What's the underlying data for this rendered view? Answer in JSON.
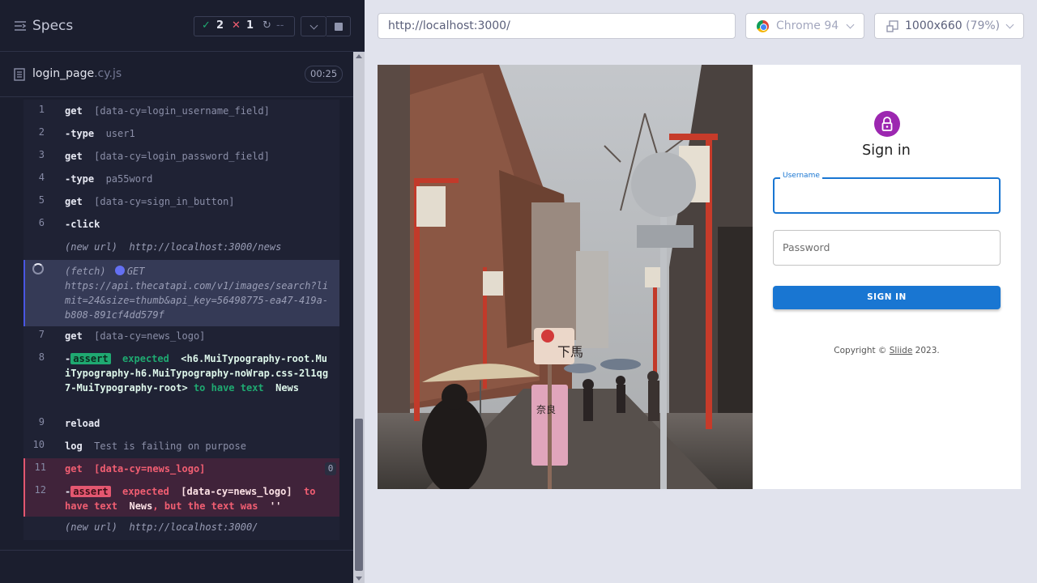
{
  "reporter": {
    "header": {
      "title": "Specs",
      "passed_count": "2",
      "failed_count": "1",
      "pending_count": "--"
    },
    "spec": {
      "file_name": "login_page",
      "file_ext": ".cy.js",
      "duration": "00:25"
    },
    "commands": [
      {
        "num": "1",
        "name": "get",
        "arg": "[data-cy=login_username_field]"
      },
      {
        "num": "2",
        "name": "-type",
        "arg": "user1"
      },
      {
        "num": "3",
        "name": "get",
        "arg": "[data-cy=login_password_field]"
      },
      {
        "num": "4",
        "name": "-type",
        "arg": "pa55word"
      },
      {
        "num": "5",
        "name": "get",
        "arg": "[data-cy=sign_in_button]"
      },
      {
        "num": "6",
        "name": "-click",
        "arg": ""
      },
      {
        "num": "",
        "name": "(new url)",
        "arg": "http://localhost:3000/news"
      },
      {
        "num": "",
        "name": "(fetch)",
        "method": "GET",
        "arg": "https://api.thecatapi.com/v1/images/search?limit=24&size=thumb&api_key=56498775-ea47-419a-b808-891cf4dd579f"
      },
      {
        "num": "7",
        "name": "get",
        "arg": "[data-cy=news_logo]"
      },
      {
        "num": "8",
        "dash": "-",
        "badge": "assert",
        "expected_label": "expected",
        "element": "<h6.MuiTypography-root.MuiTypography-h6.MuiTypography-noWrap.css-2l1qg7-MuiTypography-root>",
        "to_have": "to have text",
        "value": "News"
      },
      {
        "num": "9",
        "name": "reload",
        "arg": ""
      },
      {
        "num": "10",
        "name": "log",
        "arg": "Test is failing on purpose"
      },
      {
        "num": "11",
        "name": "get",
        "arg": "[data-cy=news_logo]",
        "count": "0"
      },
      {
        "num": "12",
        "dash": "-",
        "badge": "assert",
        "expected_label": "expected",
        "element": "[data-cy=news_logo]",
        "to_have": "to have text",
        "value": "News",
        "but": ", but the text was",
        "actual": "''"
      },
      {
        "num": "",
        "name": "(new url)",
        "arg": "http://localhost:3000/"
      }
    ]
  },
  "browser": {
    "url": "http://localhost:3000/",
    "browser_name": "Chrome 94",
    "viewport": "1000x660",
    "scale": "(79%)"
  },
  "app": {
    "title": "Sign in",
    "username_label": "Username",
    "password_placeholder": "Password",
    "signin_button": "SIGN IN",
    "copyright_prefix": "Copyright © ",
    "copyright_link": "Sliide",
    "copyright_suffix": " 2023.",
    "photo_signs": [
      "下馬",
      "奈良"
    ]
  },
  "colors": {
    "reporter_bg": "#1b1e2e",
    "pass": "#1fa971",
    "fail": "#e45770",
    "primary": "#1976d2",
    "avatar": "#9c27b0"
  }
}
